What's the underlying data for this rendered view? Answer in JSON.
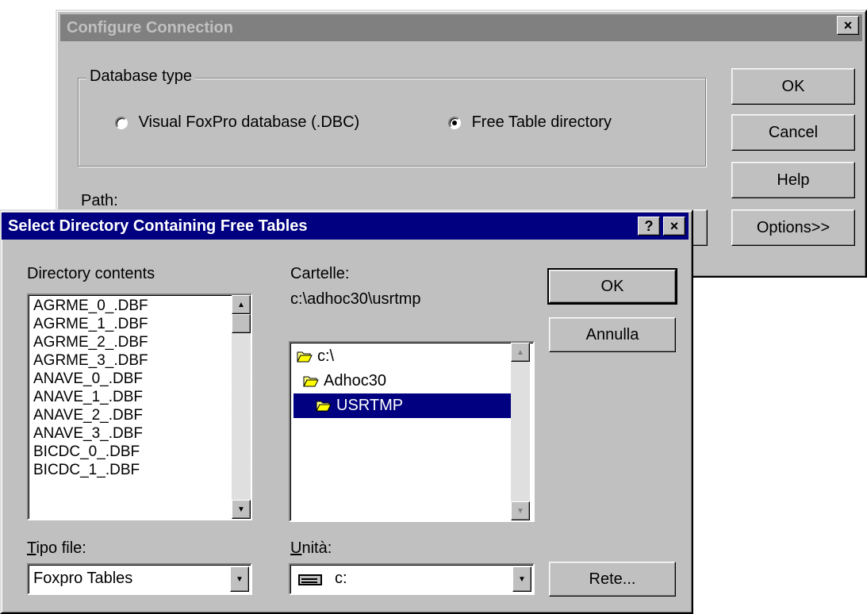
{
  "configure": {
    "title": "Configure Connection",
    "close_glyph": "×",
    "database_type_label": "Database type",
    "radio_dbc_label": "Visual FoxPro database (.DBC)",
    "radio_free_label": "Free Table directory",
    "selected_radio": "free_table_directory",
    "path_label": "Path:",
    "buttons": {
      "ok": "OK",
      "cancel": "Cancel",
      "help": "Help",
      "options": "Options>>"
    }
  },
  "select_dir": {
    "title": "Select Directory Containing Free Tables",
    "help_glyph": "?",
    "close_glyph": "×",
    "directory_contents_label": "Directory contents",
    "files": [
      "AGRME_0_.DBF",
      "AGRME_1_.DBF",
      "AGRME_2_.DBF",
      "AGRME_3_.DBF",
      "ANAVE_0_.DBF",
      "ANAVE_1_.DBF",
      "ANAVE_2_.DBF",
      "ANAVE_3_.DBF",
      "BICDC_0_.DBF",
      "BICDC_1_.DBF"
    ],
    "folders_label": "Cartelle:",
    "current_path": "c:\\adhoc30\\usrtmp",
    "folders": [
      {
        "name": "c:\\",
        "selected": false
      },
      {
        "name": "Adhoc30",
        "selected": false
      },
      {
        "name": "USRTMP",
        "selected": true
      }
    ],
    "file_type_label": "Tipo file:",
    "file_type_value": "Foxpro Tables",
    "drive_label": "Unità:",
    "drive_value": "c:",
    "buttons": {
      "ok": "OK",
      "cancel": "Annulla",
      "network": "Rete..."
    },
    "colors": {
      "selection": "#000080",
      "title_active": "#000080",
      "title_inactive": "#808080"
    }
  }
}
